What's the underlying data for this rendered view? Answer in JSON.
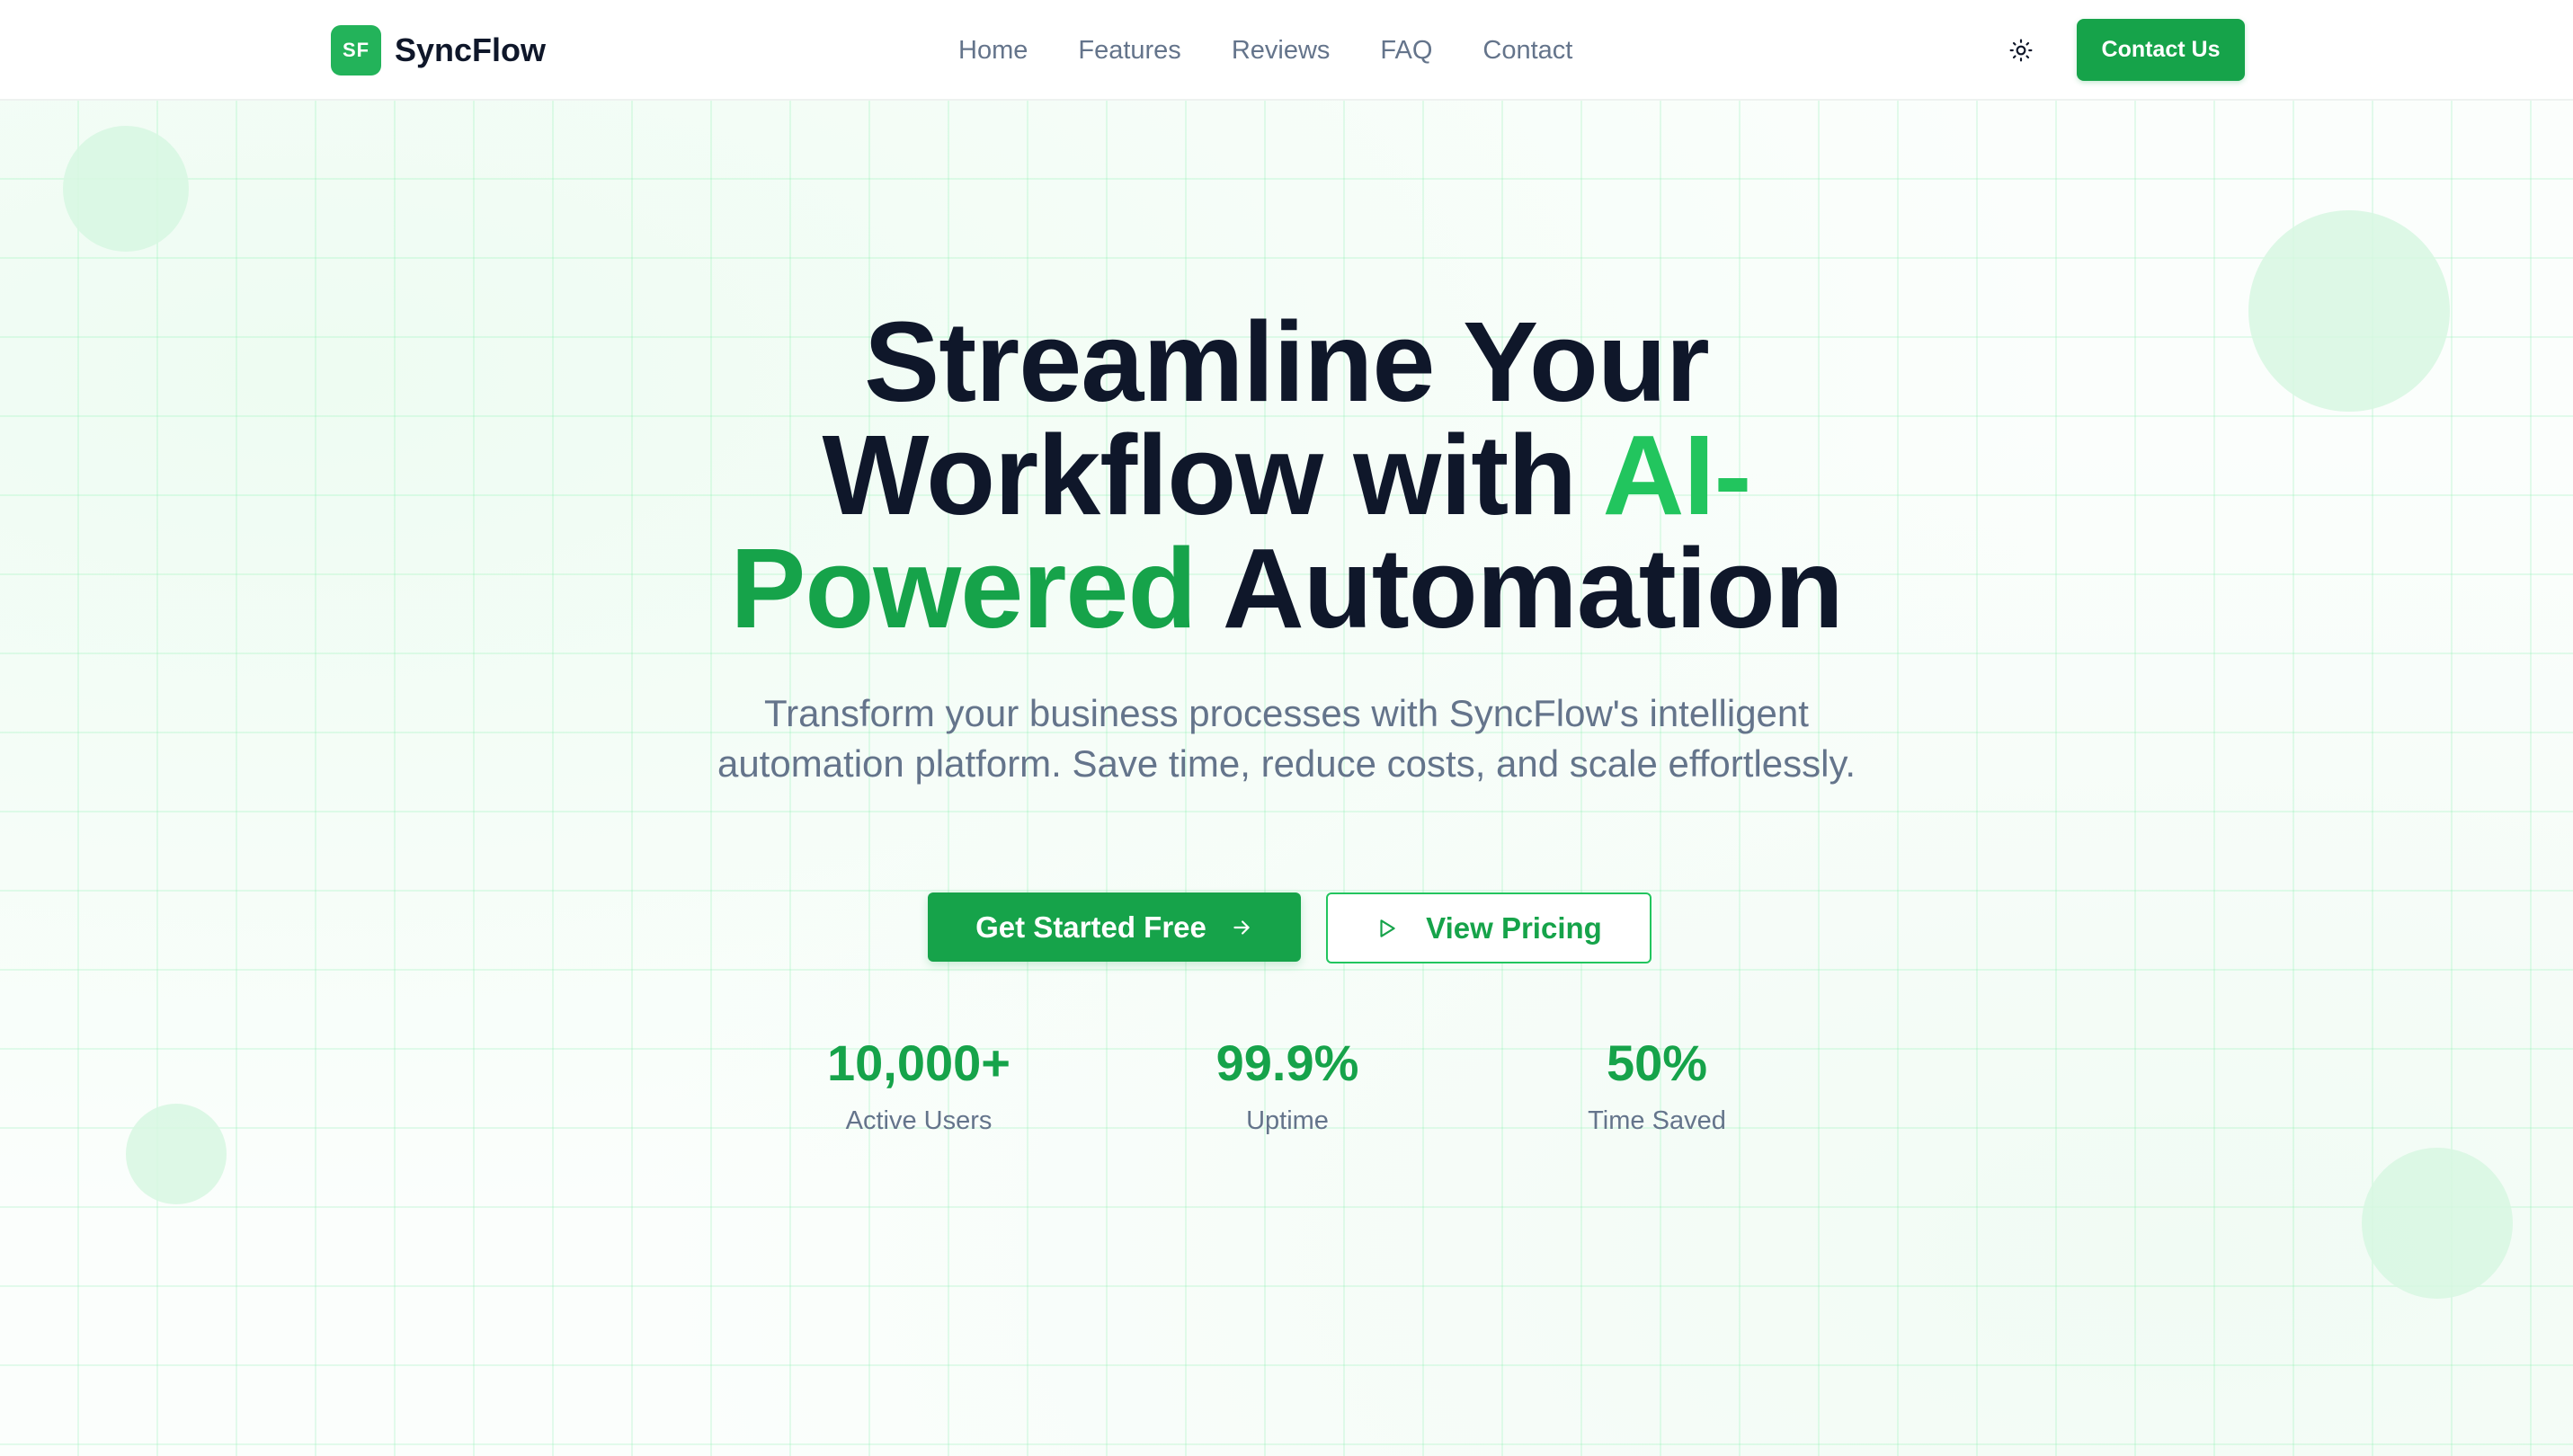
{
  "brand": {
    "logo_badge": "SF",
    "name": "SyncFlow",
    "accent_color": "#16a34a"
  },
  "nav": {
    "items": [
      {
        "label": "Home"
      },
      {
        "label": "Features"
      },
      {
        "label": "Reviews"
      },
      {
        "label": "FAQ"
      },
      {
        "label": "Contact"
      }
    ]
  },
  "header": {
    "theme_toggle_icon": "sun-icon",
    "contact_button": "Contact Us"
  },
  "hero": {
    "headline": {
      "line1": "Streamline Your",
      "line2_dark": "Workflow with ",
      "line2_accent": "AI-",
      "line3_accent": "Powered",
      "line3_dark": " Automation"
    },
    "subtitle": "Transform your business processes with SyncFlow's intelligent automation platform. Save time, reduce costs, and scale effortlessly.",
    "primary_cta": {
      "label": "Get Started Free",
      "icon": "arrow-right-icon"
    },
    "secondary_cta": {
      "label": "View Pricing",
      "icon": "play-icon"
    }
  },
  "stats": [
    {
      "value": "10,000+",
      "label": "Active Users"
    },
    {
      "value": "99.9%",
      "label": "Uptime"
    },
    {
      "value": "50%",
      "label": "Time Saved"
    }
  ]
}
